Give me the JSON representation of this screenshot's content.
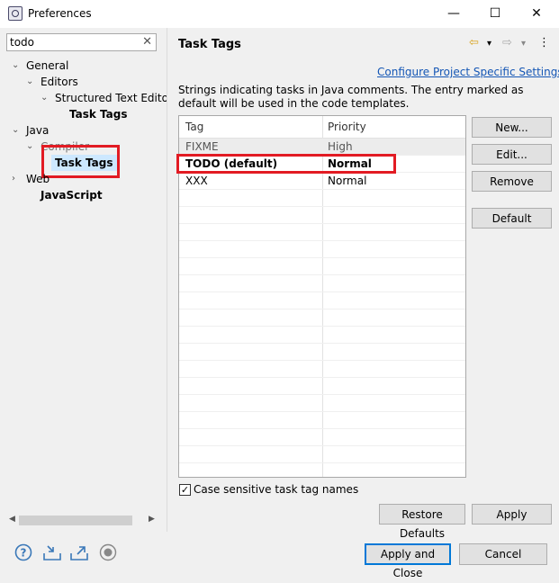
{
  "window": {
    "title": "Preferences",
    "minimize": "—",
    "maximize": "☐",
    "close": "✕"
  },
  "sidebar": {
    "filter_value": "todo",
    "filter_clear": "✕",
    "tree": [
      {
        "label": "General",
        "twisty": "⌄"
      },
      {
        "label": "Editors",
        "twisty": "⌄"
      },
      {
        "label": "Structured Text Edito",
        "twisty": "⌄"
      },
      {
        "label": "Task Tags"
      },
      {
        "label": "Java",
        "twisty": "⌄"
      },
      {
        "label": "Compiler",
        "twisty": "⌄"
      },
      {
        "label": "Task Tags"
      },
      {
        "label": "Web",
        "twisty": "›"
      },
      {
        "label": "JavaScript"
      }
    ]
  },
  "page": {
    "title": "Task Tags",
    "nav_back": "⇦",
    "nav_forward": "⇨",
    "nav_menu": "⋮",
    "dropdown": "▾",
    "link": "Configure Project Specific Settings...",
    "description": "Strings indicating tasks in Java comments. The entry marked as default will be used in the code templates."
  },
  "table": {
    "headers": [
      "Tag",
      "Priority"
    ],
    "rows": [
      {
        "tag": "FIXME",
        "priority": "High"
      },
      {
        "tag": "TODO (default)",
        "priority": "Normal"
      },
      {
        "tag": "XXX",
        "priority": "Normal"
      }
    ]
  },
  "buttons": {
    "new": "New...",
    "edit": "Edit...",
    "remove": "Remove",
    "default": "Default",
    "restore_defaults": "Restore Defaults",
    "apply": "Apply",
    "apply_and_close": "Apply and Close",
    "cancel": "Cancel"
  },
  "options": {
    "case_sensitive_label": "Case sensitive task tag names",
    "case_sensitive_checked": "✓"
  },
  "colors": {
    "highlight": "#e21b23",
    "link": "#1456b5",
    "selection": "#cde8ff"
  },
  "icons": [
    "help-icon",
    "import-icon",
    "export-icon",
    "record-icon"
  ]
}
